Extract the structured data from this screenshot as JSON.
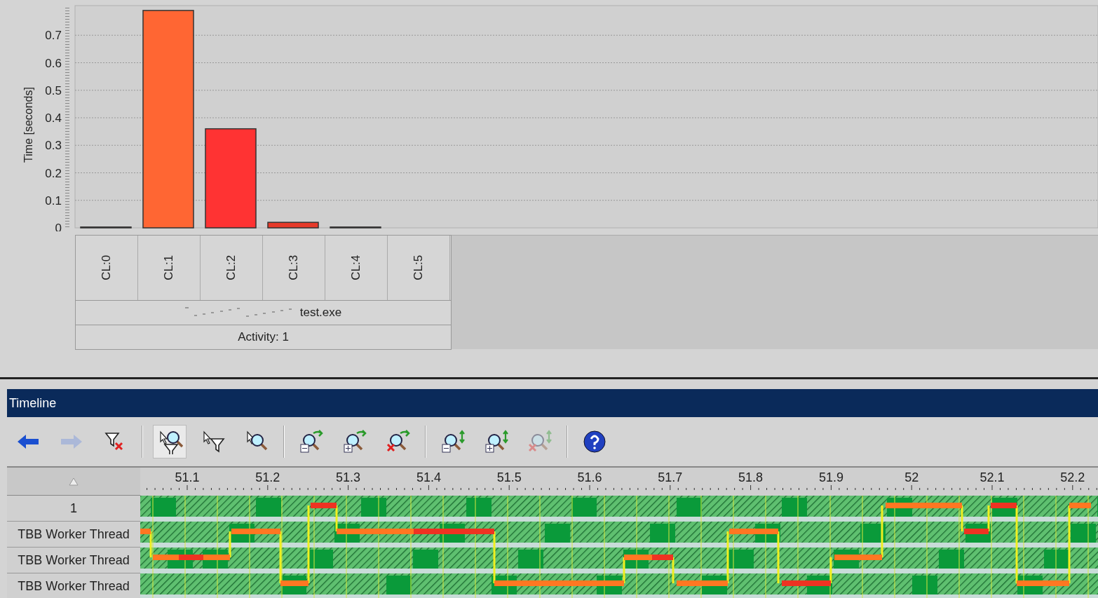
{
  "chart": {
    "chart_data": {
      "type": "bar",
      "ylabel": "Time [seconds]",
      "categories": [
        "CL:0",
        "CL:1",
        "CL:2",
        "CL:3",
        "CL:4",
        "CL:5"
      ],
      "series": [
        {
          "color": "#ff6633",
          "values": [
            0.003,
            0.79,
            null,
            null,
            0.003,
            null
          ]
        },
        {
          "color": "#ff3333",
          "values": [
            null,
            null,
            0.36,
            null,
            null,
            null
          ]
        },
        {
          "color": "#e63a2a",
          "values": [
            null,
            null,
            null,
            0.02,
            null,
            null
          ]
        }
      ],
      "stacked": true,
      "grid": true,
      "ylim": [
        0,
        0.8
      ],
      "yticks": [
        0,
        0.1,
        0.2,
        0.3,
        0.4,
        0.5,
        0.6,
        0.7
      ]
    },
    "group_label": "test.exe",
    "activity_label": "Activity: 1"
  },
  "timeline": {
    "title": "Timeline",
    "tools": [
      {
        "kind": "back",
        "disabled": false,
        "selected": false
      },
      {
        "kind": "forward",
        "disabled": true,
        "selected": false
      },
      {
        "kind": "clear-filter",
        "disabled": false,
        "selected": false
      },
      {
        "kind": "separator"
      },
      {
        "kind": "select-zoom-filter",
        "disabled": false,
        "selected": true
      },
      {
        "kind": "select-filter",
        "disabled": false,
        "selected": false
      },
      {
        "kind": "select-zoom",
        "disabled": false,
        "selected": false
      },
      {
        "kind": "separator"
      },
      {
        "kind": "zoom-minus",
        "disabled": false,
        "selected": false
      },
      {
        "kind": "zoom-plus",
        "disabled": false,
        "selected": false
      },
      {
        "kind": "zoom-remove",
        "disabled": false,
        "selected": false
      },
      {
        "kind": "separator"
      },
      {
        "kind": "vzoom-minus",
        "disabled": false,
        "selected": false
      },
      {
        "kind": "vzoom-plus",
        "disabled": false,
        "selected": false
      },
      {
        "kind": "vzoom-remove",
        "disabled": true,
        "selected": false
      },
      {
        "kind": "separator"
      },
      {
        "kind": "help",
        "disabled": false,
        "selected": false
      }
    ],
    "ticks": [
      "51.1",
      "51.2",
      "51.3",
      "51.4",
      "51.5",
      "51.6",
      "51.7",
      "51.8",
      "51.9",
      "52",
      "52.1",
      "52.2"
    ],
    "rows": [
      "1",
      "TBB Worker Thread",
      "TBB Worker Thread",
      "TBB Worker Thread"
    ]
  }
}
